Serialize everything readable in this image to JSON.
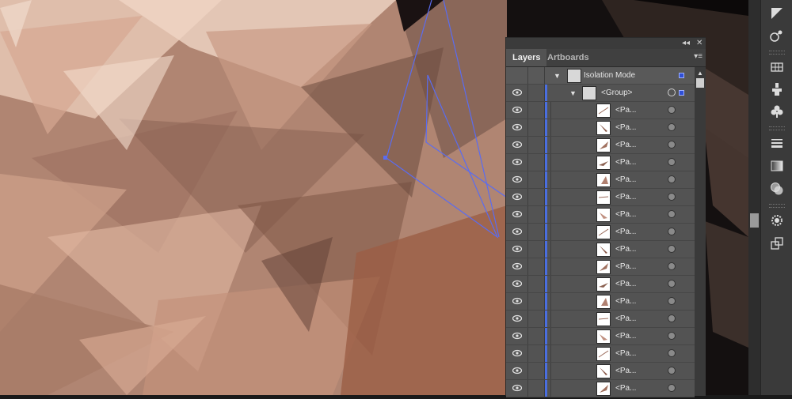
{
  "panel": {
    "tabs": [
      "Layers",
      "Artboards"
    ],
    "header_controls": {
      "collapse": "◂◂",
      "close": "✕",
      "menu": "▾≡"
    }
  },
  "rows": {
    "isolation": {
      "label": "Isolation Mode"
    },
    "group": {
      "label": "<Group>"
    },
    "path_label": "<Pa..."
  },
  "toolbar": {
    "icons": [
      "pathfinder-icon",
      "symbols-sprayer-icon",
      "grid-icon",
      "puppet-icon",
      "club-symbol-icon",
      "stroke-icon",
      "gradient-icon",
      "transparency-icon",
      "appearance-icon",
      "export-icon"
    ]
  },
  "colors": {
    "selection": "#4a6ee0",
    "panel": "#535353",
    "artwork_base": "#b08572"
  }
}
